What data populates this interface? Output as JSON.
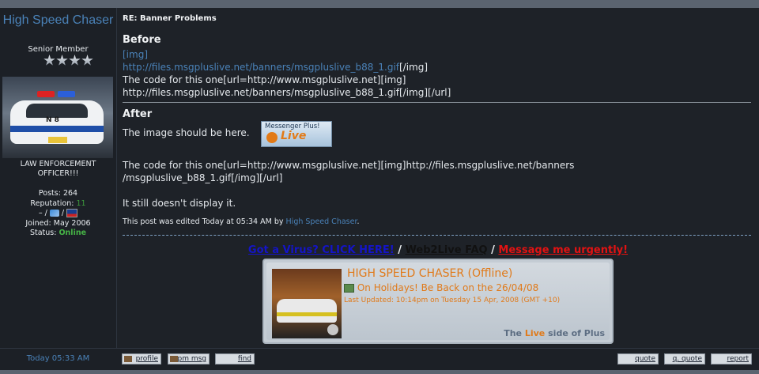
{
  "author": {
    "username": "High Speed Chaser",
    "rank": "Senior Member",
    "title_line1": "LAW ENFORCEMENT",
    "title_line2": "OFFICER!!!",
    "posts_label": "Posts:",
    "posts": "264",
    "reputation_label": "Reputation:",
    "reputation": "11",
    "contact_prefix": "– /",
    "contact_sep": "/",
    "joined_label": "Joined:",
    "joined": "May 2006",
    "status_label": "Status:",
    "status": "Online",
    "avatar_plate_text": "N 8",
    "star_count": 4
  },
  "post": {
    "title": "RE: Banner Problems",
    "before_heading": "Before",
    "img_tag": "[img]",
    "img_url": "http://files.msgpluslive.net/banners/msgpluslive_b88_1.gif",
    "img_close": "[/img]",
    "code_line1": "The code for this one[url=http://www.msgpluslive.net][img]",
    "code_line2": "http://files.msgpluslive.net/banners/msgpluslive_b88_1.gif[/img][/url]",
    "after_heading": "After",
    "image_should_be": "The image should be here.",
    "banner_text1": "Messenger Plus!",
    "banner_text2": "Live",
    "code2_line1": "The code for this one[url=http://www.msgpluslive.net][img]http://files.msgpluslive.net/banners",
    "code2_line2": "/msgpluslive_b88_1.gif[/img][/url]",
    "still_text": "It still doesn't display it.",
    "edited_prefix": "This post was edited Today at 05:34 AM by",
    "edited_by": "High Speed Chaser",
    "edited_suffix": "."
  },
  "signature": {
    "link1": "Got a Virus? CLICK HERE!",
    "link2": "Web2Live FAQ",
    "link3": "Message me urgently!",
    "separator": "/",
    "card_name": "HIGH SPEED CHASER  (Offline)",
    "card_status": "On Holidays!  Be Back on the 26/04/08",
    "card_updated": "Last Updated: 10:14pm on Tuesday 15 Apr, 2008 (GMT +10)",
    "card_tag_pre": "The",
    "card_tag_live": "Live",
    "card_tag_post": "side of Plus"
  },
  "footer": {
    "post_time": "Today 05:33 AM",
    "profile": "profile",
    "pm": "pm msg",
    "find": "find",
    "quote": "quote",
    "q_quote": "q. quote",
    "report": "report"
  }
}
